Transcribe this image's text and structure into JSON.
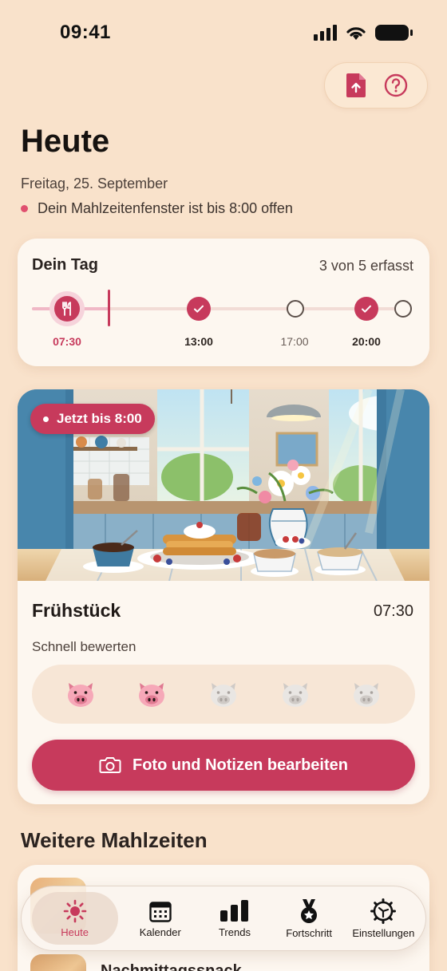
{
  "status_bar": {
    "time": "09:41"
  },
  "header": {
    "title": "Heute",
    "date": "Freitag, 25. September",
    "window_status": "Dein Mahlzeitenfenster ist bis 8:00 offen"
  },
  "day_card": {
    "title": "Dein Tag",
    "count": "3 von 5 erfasst",
    "timeline": [
      {
        "time": "07:30",
        "state": "current"
      },
      {
        "time": "13:00",
        "state": "done"
      },
      {
        "time": "17:00",
        "state": "open"
      },
      {
        "time": "20:00",
        "state": "done"
      },
      {
        "time": "",
        "state": "open"
      }
    ]
  },
  "meal_card": {
    "badge": "Jetzt bis 8:00",
    "name": "Frühstück",
    "time": "07:30",
    "quick_rate_label": "Schnell bewerten",
    "rating": {
      "value": 2,
      "max": 5
    },
    "edit_button": "Foto und Notizen bearbeiten"
  },
  "more_meals": {
    "title": "Weitere Mahlzeiten",
    "second_item": "Nachmittagssnack"
  },
  "tabs": [
    {
      "label": "Heute",
      "icon": "sun-icon",
      "active": true
    },
    {
      "label": "Kalender",
      "icon": "calendar-icon",
      "active": false
    },
    {
      "label": "Trends",
      "icon": "bar-chart-icon",
      "active": false
    },
    {
      "label": "Fortschritt",
      "icon": "medal-icon",
      "active": false
    },
    {
      "label": "Einstellungen",
      "icon": "gear-icon",
      "active": false
    }
  ],
  "colors": {
    "accent": "#c73a5c",
    "background": "#f9e2cb",
    "card": "#fdf7f0"
  }
}
